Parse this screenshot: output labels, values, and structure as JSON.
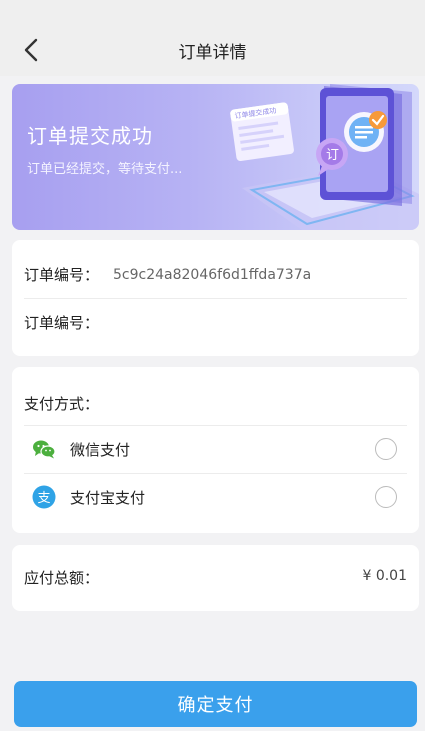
{
  "nav": {
    "title": "订单详情",
    "back_icon": "chevron-left-icon"
  },
  "banner": {
    "title": "订单提交成功",
    "subtitle": "订单已经提交，等待支付...",
    "art_caption": "订单提交成功"
  },
  "order_info": {
    "order_no_label": "订单编号：",
    "order_no_value": "5c9c24a82046f6d1ffda737a",
    "second_label": "订单编号："
  },
  "payment": {
    "title": "支付方式：",
    "options": [
      {
        "label": "微信支付",
        "icon": "wechat-icon",
        "selected": false
      },
      {
        "label": "支付宝支付",
        "icon": "alipay-icon",
        "selected": false
      }
    ]
  },
  "total": {
    "label": "应付总额：",
    "value": "¥ 0.01"
  },
  "confirm_label": "确定支付",
  "colors": {
    "accent": "#3aa0ec",
    "wechat": "#4caf3e",
    "alipay": "#2fa3e6",
    "banner": "#a79ff0"
  }
}
